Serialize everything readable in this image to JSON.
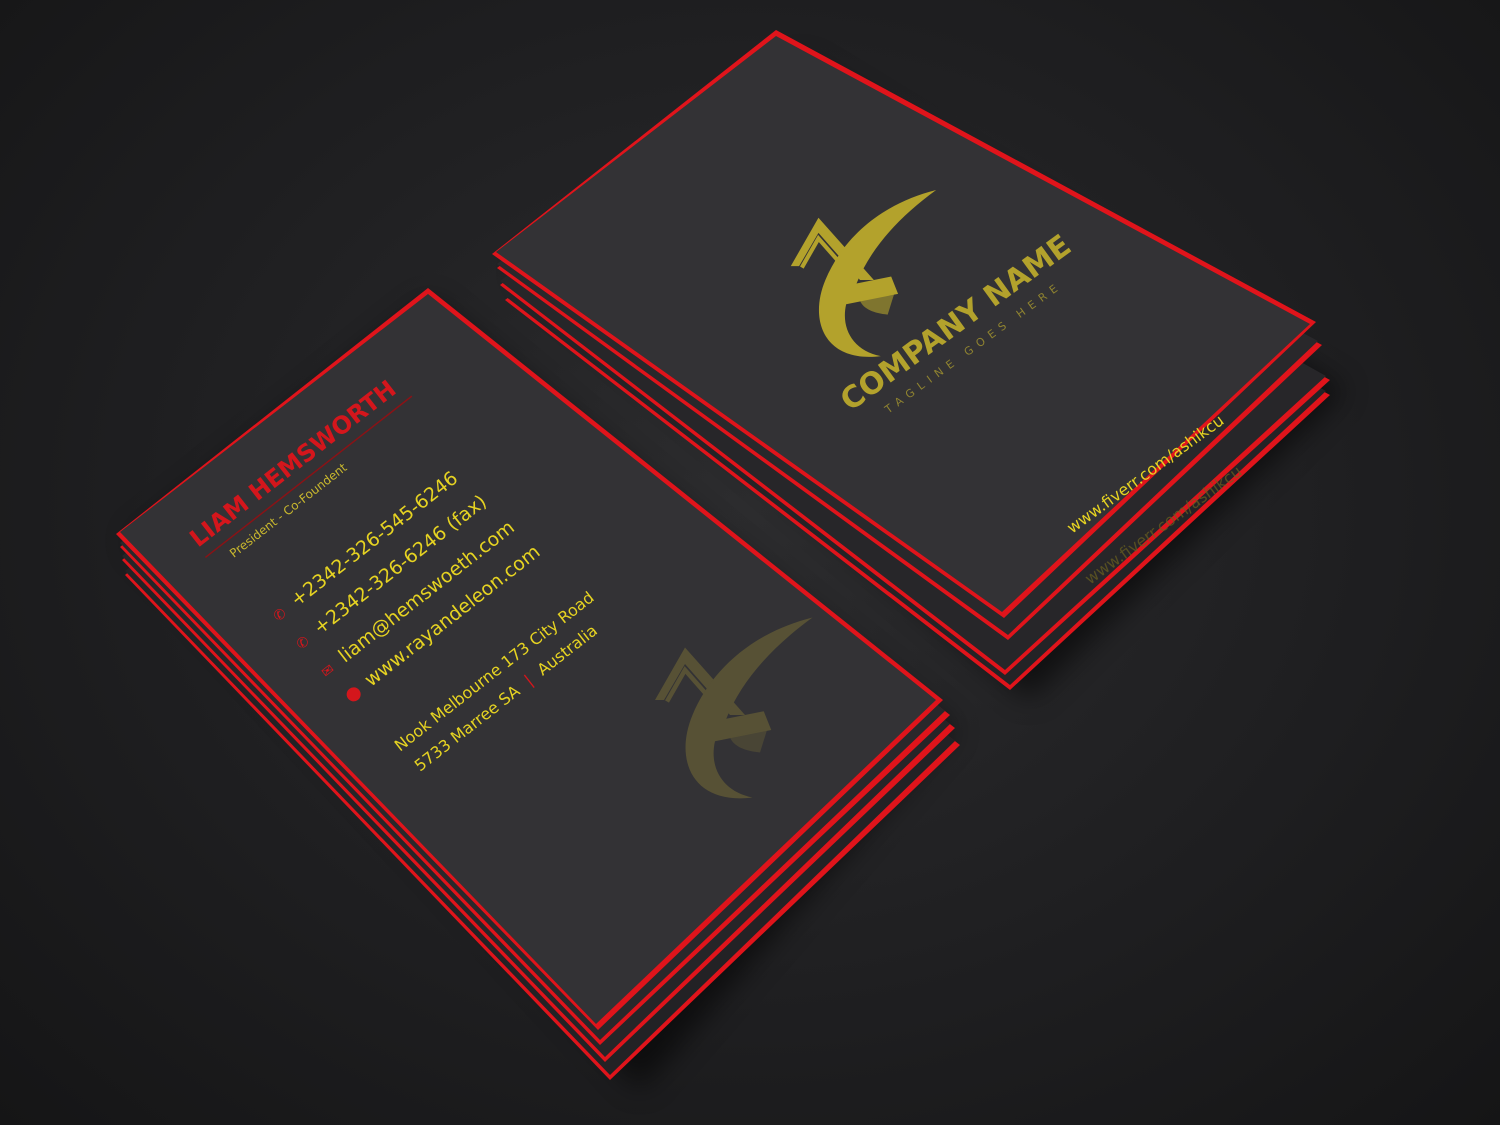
{
  "colors": {
    "background": "#1f1f21",
    "card_face": "#333235",
    "card_edge_red": "#e0141b",
    "gold": "#b3a22c",
    "yellow_text": "#e6d322",
    "red_text": "#d4161c"
  },
  "front_card": {
    "name": "LIAM HEMSWORTH",
    "role": "President - Co-Foundent",
    "contacts": [
      {
        "icon": "phone-icon",
        "text": "+2342-326-545-6246"
      },
      {
        "icon": "phone-icon",
        "text": "+2342-326-6246 (fax)"
      },
      {
        "icon": "email-icon",
        "text": "liam@hemswoeth.com"
      },
      {
        "icon": "globe-icon",
        "text": "www.rayandeleon.com"
      }
    ],
    "address_line1": "Nook Melbourne 173 City Road",
    "address_line2_part1": "5733 Marree SA",
    "address_separator": "|",
    "address_line2_part2": "Australia",
    "watermark": "ae-monogram-logo"
  },
  "back_card": {
    "logo": "ae-monogram-logo",
    "company_name": "COMPANY NAME",
    "tagline": "TAGLINE GOES HERE",
    "url": "www.fiverr.com/ashikcu",
    "url_edge_ghost": "www.fiverr.com/ashikcu"
  }
}
